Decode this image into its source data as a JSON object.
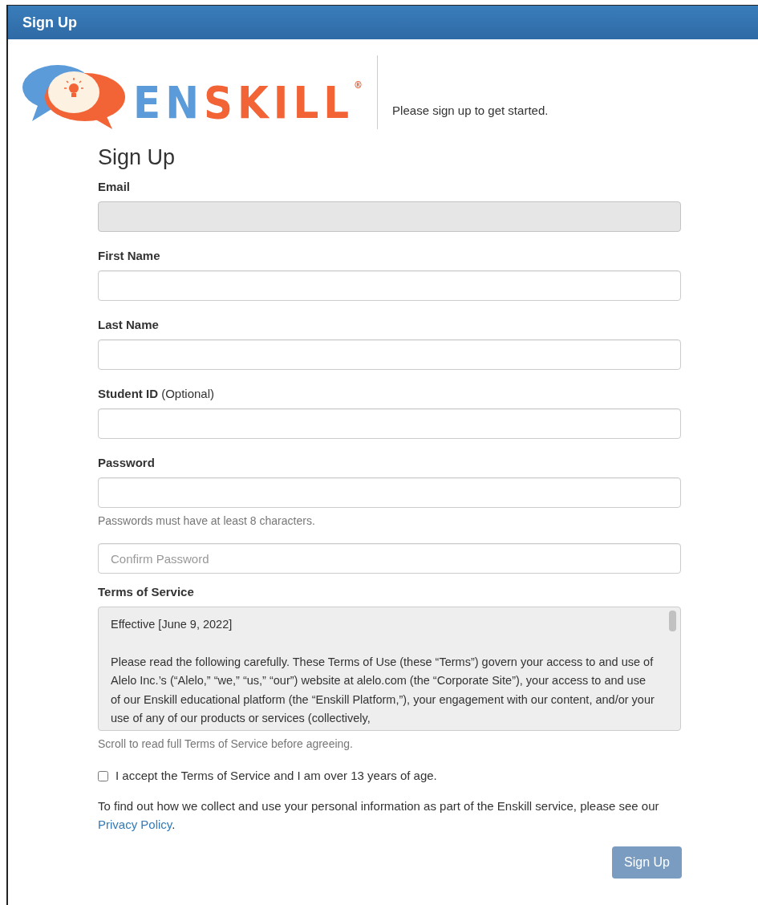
{
  "window": {
    "title": "Sign Up"
  },
  "logo": {
    "parts": [
      {
        "text": "EN",
        "color": "#5b9bd9"
      },
      {
        "text": "SKILL",
        "color": "#f26336"
      }
    ],
    "mark": "®"
  },
  "tagline": "Please sign up to get started.",
  "heading": "Sign Up",
  "fields": [
    {
      "label": "Email",
      "disabled": true
    },
    {
      "label": "First Name",
      "disabled": false
    },
    {
      "label": "Last Name",
      "disabled": false
    },
    {
      "label": "**Student ID** (Optional)",
      "disabled": false
    },
    {
      "label": "Password",
      "disabled": false,
      "help": "Passwords must have at least 8 characters."
    },
    {
      "placeholder": "Confirm Password",
      "disabled": false
    }
  ],
  "terms": {
    "label": "Terms of Service",
    "paragraphs": [
      "Effective [June 9, 2022]",
      "Please read the following carefully. These Terms of Use (these “Terms”) govern your access to and use of Alelo Inc.’s (“Alelo,” “we,” “us,” “our”) website at alelo.com (the “Corporate Site”), your access to and use of our Enskill educational platform (the “Enskill Platform,”), your engagement with our content, and/or your use of any of our products or services (collectively,"
    ],
    "help": "Scroll to read full Terms of Service before agreeing."
  },
  "accept": {
    "label": "I accept the Terms of Service and I am over 13 years of age.",
    "checked": false
  },
  "privacy_notice": {
    "before": "To find out how we collect and use your personal information as part of the Enskill service, please see our ",
    "link": "Privacy Policy",
    "after": "."
  },
  "submit": {
    "label": "Sign Up",
    "disabled": true
  }
}
